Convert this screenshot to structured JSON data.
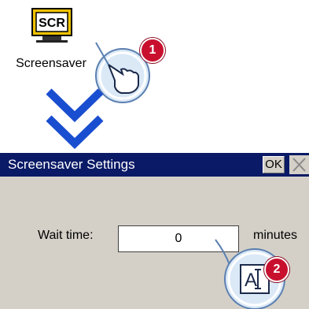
{
  "desktop_icon": {
    "glyph": "SCR",
    "label": "Screensaver"
  },
  "callouts": [
    {
      "step": "1",
      "icon": "hand-pointer-icon"
    },
    {
      "step": "2",
      "glyph": "A"
    }
  ],
  "dialog": {
    "title": "Screensaver Settings",
    "ok_label": "OK",
    "wait_label": "Wait time:",
    "wait_value": "0",
    "unit": "minutes"
  },
  "colors": {
    "titlebar": "#0b1a66",
    "dialog_bg": "#d4d0c8",
    "arrow": "#1a4ed0",
    "badge": "#c8102e"
  }
}
